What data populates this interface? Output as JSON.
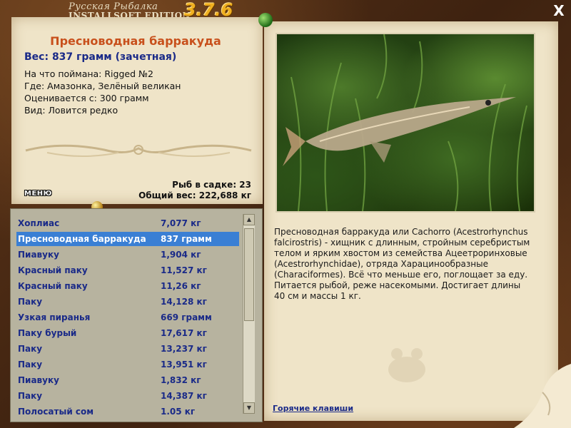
{
  "brand": {
    "line1": "Русская Рыбалка",
    "line2": "INSTALLSOFT EDITION",
    "version": "3.7.6"
  },
  "close_label": "X",
  "fish": {
    "title": "Пресноводная барракуда",
    "weight": "Вес: 837 грамм (зачетная)",
    "info": [
      "На что поймана: Rigged №2",
      "Где: Амазонка, Зелёный великан",
      "Оценивается с: 300 грамм",
      "Вид: Ловится редко"
    ]
  },
  "stats": {
    "count": "Рыб в садке: 23",
    "total": "Общий вес: 222,688 кг"
  },
  "menu_label": "МЕНЮ",
  "catch_list": [
    {
      "name": "Хоплиас",
      "weight": "7,077 кг"
    },
    {
      "name": "Пресноводная барракуда",
      "weight": "837 грамм"
    },
    {
      "name": "Пиавуку",
      "weight": "1,904 кг"
    },
    {
      "name": "Красный паку",
      "weight": "11,527 кг"
    },
    {
      "name": "Красный паку",
      "weight": "11,26 кг"
    },
    {
      "name": "Паку",
      "weight": "14,128 кг"
    },
    {
      "name": "Узкая пиранья",
      "weight": "669 грамм"
    },
    {
      "name": "Паку бурый",
      "weight": "17,617 кг"
    },
    {
      "name": "Паку",
      "weight": "13,237 кг"
    },
    {
      "name": "Паку",
      "weight": "13,951 кг"
    },
    {
      "name": "Пиавуку",
      "weight": "1,832 кг"
    },
    {
      "name": "Паку",
      "weight": "14,387 кг"
    },
    {
      "name": "Полосатый сом",
      "weight": "1.05 кг"
    }
  ],
  "selected_index": 1,
  "description": "Пресноводная барракуда или Cachorro (Acestrorhynchus falcirostris) - хищник с длинным, стройным серебристым телом и ярким хвостом из семейства Ацеетроринховые (Acestrorhynchidae), отряда Харацинообразные (Characiformes). Всё что меньше его, поглощает за еду. Питается рыбой, реже насекомыми. Достигает длины 40 см и массы 1 кг.",
  "hotkeys_label": "Горячие клавиши",
  "colors": {
    "title": "#c8501c",
    "weight": "#1a2a88",
    "selection": "#3a7fd4",
    "version": "#f0b020"
  }
}
